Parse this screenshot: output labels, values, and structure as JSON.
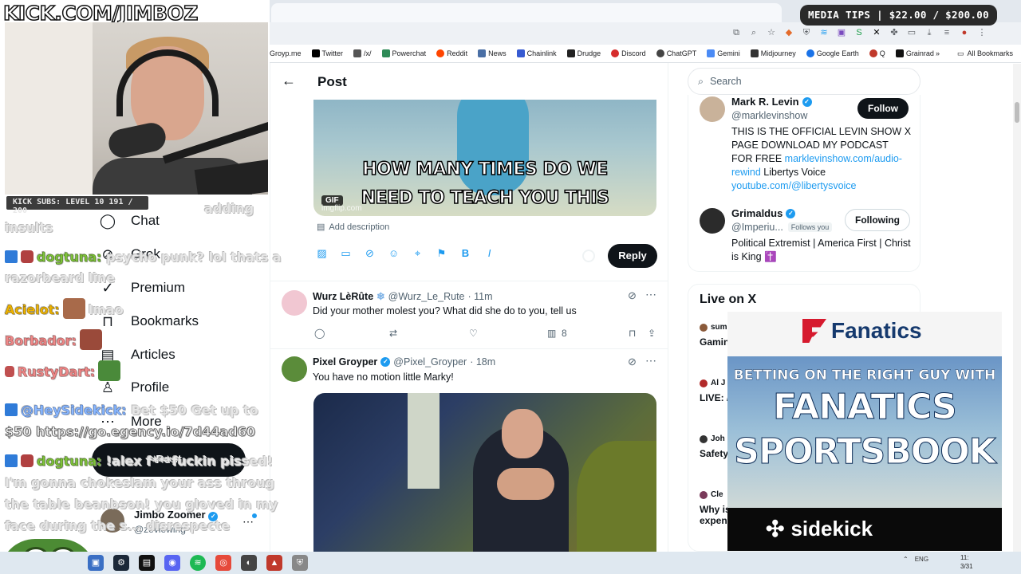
{
  "stream": {
    "brand": "KICK.COM/JIMBOZ",
    "subs_bar": "KICK SUBS: LEVEL 10 191 / 200",
    "media_tips": "MEDIA TIPS | $22.00 / $200.00"
  },
  "bookmarks": {
    "items": [
      "Groyp.me",
      "Twitter",
      "/x/",
      "Powerchat",
      "Reddit",
      "News",
      "Chainlink",
      "Drudge",
      "Discord",
      "ChatGPT",
      "Gemini",
      "Midjourney",
      "Google Earth",
      "Q",
      "Grainrad"
    ],
    "all": "All Bookmarks"
  },
  "nav": {
    "items": [
      {
        "label": "Chat",
        "icon": "chat-icon"
      },
      {
        "label": "Grok",
        "icon": "grok-icon"
      },
      {
        "label": "Premium",
        "icon": "premium-icon"
      },
      {
        "label": "Bookmarks",
        "icon": "bookmark-icon"
      },
      {
        "label": "Articles",
        "icon": "articles-icon"
      },
      {
        "label": "Profile",
        "icon": "profile-icon"
      },
      {
        "label": "More",
        "icon": "more-icon"
      }
    ],
    "post_label": "Post",
    "user_name": "Jimbo Zoomer",
    "user_handle": "@zeviewing"
  },
  "chat": {
    "lines": [
      {
        "user": "",
        "text": "adding"
      },
      {
        "user": "",
        "text": "insults"
      },
      {
        "user": "dogtuna:",
        "text": "psycho punk? lol thats a"
      },
      {
        "user": "",
        "text": "razorbeard line"
      },
      {
        "user": "Acielot:",
        "text": "lmao"
      },
      {
        "user": "Borbador:",
        "text": ""
      },
      {
        "user": "RustyDart:",
        "text": ""
      },
      {
        "user": "@HeySidekick:",
        "text": "Bet $50 Get up to"
      },
      {
        "user": "",
        "text": "$50 https://go.egency.io/7d44ad60"
      },
      {
        "user": "dogtuna:",
        "text": "!alex f***fuckin pissed!"
      },
      {
        "user": "",
        "text": "I'm gonna chokeslam your ass throug"
      },
      {
        "user": "",
        "text": "the table beanbson! you gloved in my"
      },
      {
        "user": "",
        "text": "face during the s... disrespecte"
      }
    ]
  },
  "main": {
    "title": "Post",
    "gif_caption": "HOW MANY TIMES DO WE NEED TO TEACH YOU THIS LESSON, OLD MAN",
    "gif_badge": "GIF",
    "gif_watermark": "imgflip.com",
    "add_description": "Add description",
    "reply_label": "Reply",
    "tweets": [
      {
        "name": "Wurz LèRûte",
        "handle": "@Wurz_Le_Rute",
        "time": "· 11m",
        "text": "Did your mother molest you? What did she do to you, tell us",
        "views": "8"
      },
      {
        "name": "Pixel Groyper",
        "handle": "@Pixel_Groyper",
        "time": "· 18m",
        "text": "You have no motion little Marky!"
      }
    ]
  },
  "right": {
    "search_placeholder": "Search",
    "who": [
      {
        "name": "Mark R. Levin",
        "handle": "@marklevinshow",
        "button": "Follow",
        "bio_text": "THIS IS THE OFFICIAL LEVIN SHOW X PAGE DOWNLOAD MY PODCAST FOR FREE ",
        "bio_link1": "marklevinshow.com/audio-rewind",
        "bio_mid": " Libertys Voice ",
        "bio_link2": "youtube.com/@libertysvoice"
      },
      {
        "name": "Grimaldus",
        "handle": "@Imperiu...",
        "follows_you": "Follows you",
        "button": "Following",
        "bio_text": "Political Extremist | America First | Christ is King ✝️"
      }
    ],
    "live": {
      "title": "Live on X",
      "items": [
        {
          "source": "sum",
          "text": "Gamin"
        },
        {
          "source": "Al J",
          "text": "LIVE: /"
        },
        {
          "source": "Joh",
          "text": "Safety"
        },
        {
          "source": "Cle",
          "text": "Why is"
        },
        {
          "source": "",
          "text": "expen"
        }
      ]
    }
  },
  "ad": {
    "brand": "Fanatics",
    "tagline": "BETTING ON THE RIGHT GUY WITH",
    "line1": "FANATICS",
    "line2": "SPORTSBOOK",
    "sponsor": "sidekick"
  },
  "taskbar": {
    "lang": "ENG",
    "time": "11:",
    "date": "3/31"
  }
}
